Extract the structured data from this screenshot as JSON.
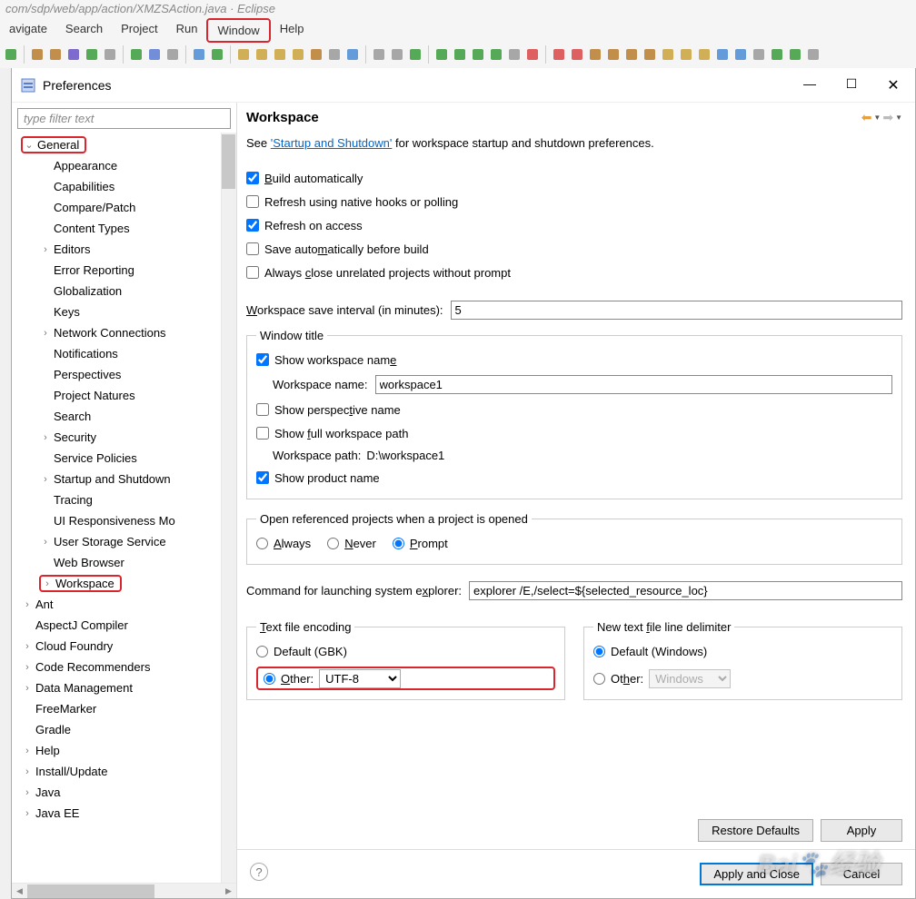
{
  "eclipse": {
    "title_fragment": "com/sdp/web/app/action/XMZSAction.java · Eclipse",
    "menus": [
      "avigate",
      "Search",
      "Project",
      "Run",
      "Window",
      "Help"
    ]
  },
  "dialog": {
    "title": "Preferences",
    "filter_placeholder": "type filter text",
    "content_title": "Workspace",
    "hint_prefix": "See ",
    "hint_link": "'Startup and Shutdown'",
    "hint_suffix": " for workspace startup and shutdown preferences.",
    "checkboxes": {
      "build_auto": "Build automatically",
      "refresh_native": "Refresh using native hooks or polling",
      "refresh_access": "Refresh on access",
      "save_before_build": "Save automatically before build",
      "close_unrelated": "Always close unrelated projects without prompt"
    },
    "interval_label": "Workspace save interval (in minutes):",
    "interval_value": "5",
    "wt": {
      "legend": "Window title",
      "show_ws_name": "Show workspace name",
      "ws_name_label": "Workspace name:",
      "ws_name_value": "workspace1",
      "show_perspective": "Show perspective name",
      "show_full_path": "Show full workspace path",
      "ws_path_label": "Workspace path:",
      "ws_path_value": "D:\\workspace1",
      "show_product": "Show product name"
    },
    "open_ref": {
      "legend": "Open referenced projects when a project is opened",
      "always": "Always",
      "never": "Never",
      "prompt": "Prompt"
    },
    "explorer_label": "Command for launching system explorer:",
    "explorer_value": "explorer /E,/select=${selected_resource_loc}",
    "encoding": {
      "legend": "Text file encoding",
      "default_label": "Default (GBK)",
      "other_label": "Other:",
      "other_value": "UTF-8"
    },
    "delimiter": {
      "legend": "New text file line delimiter",
      "default_label": "Default (Windows)",
      "other_label": "Other:",
      "other_value": "Windows"
    },
    "buttons": {
      "restore": "Restore Defaults",
      "apply": "Apply",
      "apply_close": "Apply and Close",
      "cancel": "Cancel"
    }
  },
  "tree": [
    {
      "l": 0,
      "exp": "v",
      "label": "General",
      "hl": true
    },
    {
      "l": 1,
      "exp": "",
      "label": "Appearance"
    },
    {
      "l": 1,
      "exp": "",
      "label": "Capabilities"
    },
    {
      "l": 1,
      "exp": "",
      "label": "Compare/Patch"
    },
    {
      "l": 1,
      "exp": "",
      "label": "Content Types"
    },
    {
      "l": 1,
      "exp": ">",
      "label": "Editors"
    },
    {
      "l": 1,
      "exp": "",
      "label": "Error Reporting"
    },
    {
      "l": 1,
      "exp": "",
      "label": "Globalization"
    },
    {
      "l": 1,
      "exp": "",
      "label": "Keys"
    },
    {
      "l": 1,
      "exp": ">",
      "label": "Network Connections"
    },
    {
      "l": 1,
      "exp": "",
      "label": "Notifications"
    },
    {
      "l": 1,
      "exp": "",
      "label": "Perspectives"
    },
    {
      "l": 1,
      "exp": "",
      "label": "Project Natures"
    },
    {
      "l": 1,
      "exp": "",
      "label": "Search"
    },
    {
      "l": 1,
      "exp": ">",
      "label": "Security"
    },
    {
      "l": 1,
      "exp": "",
      "label": "Service Policies"
    },
    {
      "l": 1,
      "exp": ">",
      "label": "Startup and Shutdown"
    },
    {
      "l": 1,
      "exp": "",
      "label": "Tracing"
    },
    {
      "l": 1,
      "exp": "",
      "label": "UI Responsiveness Mo"
    },
    {
      "l": 1,
      "exp": ">",
      "label": "User Storage Service"
    },
    {
      "l": 1,
      "exp": "",
      "label": "Web Browser"
    },
    {
      "l": 1,
      "exp": ">",
      "label": "Workspace",
      "hl": true
    },
    {
      "l": 0,
      "exp": ">",
      "label": "Ant"
    },
    {
      "l": 0,
      "exp": "",
      "label": "AspectJ Compiler"
    },
    {
      "l": 0,
      "exp": ">",
      "label": "Cloud Foundry"
    },
    {
      "l": 0,
      "exp": ">",
      "label": "Code Recommenders"
    },
    {
      "l": 0,
      "exp": ">",
      "label": "Data Management"
    },
    {
      "l": 0,
      "exp": "",
      "label": "FreeMarker"
    },
    {
      "l": 0,
      "exp": "",
      "label": "Gradle"
    },
    {
      "l": 0,
      "exp": ">",
      "label": "Help"
    },
    {
      "l": 0,
      "exp": ">",
      "label": "Install/Update"
    },
    {
      "l": 0,
      "exp": ">",
      "label": "Java"
    },
    {
      "l": 0,
      "exp": ">",
      "label": "Java EE"
    }
  ],
  "toolbar_colors": [
    "#3a9b3a",
    "#b77b2e",
    "#b77b2e",
    "#6a52c5",
    "#3a9b3a",
    "#999",
    "#3a9b3a",
    "#5a7bd4",
    "#999",
    "#4a8bd4",
    "#3a9b3a",
    "#c9a23a",
    "#c9a23a",
    "#c9a23a",
    "#c9a23a",
    "#b77b2e",
    "#999",
    "#4a8bd4",
    "#999",
    "#999",
    "#3a9b3a",
    "#3a9b3a",
    "#3a9b3a",
    "#3a9b3a",
    "#3a9b3a",
    "#999",
    "#d94545",
    "#d94545",
    "#d94545",
    "#b77b2e",
    "#b77b2e",
    "#b77b2e",
    "#b77b2e",
    "#c9a23a",
    "#c9a23a",
    "#c9a23a",
    "#4a8bd4",
    "#4a8bd4",
    "#999",
    "#3a9b3a",
    "#3a9b3a",
    "#999"
  ]
}
